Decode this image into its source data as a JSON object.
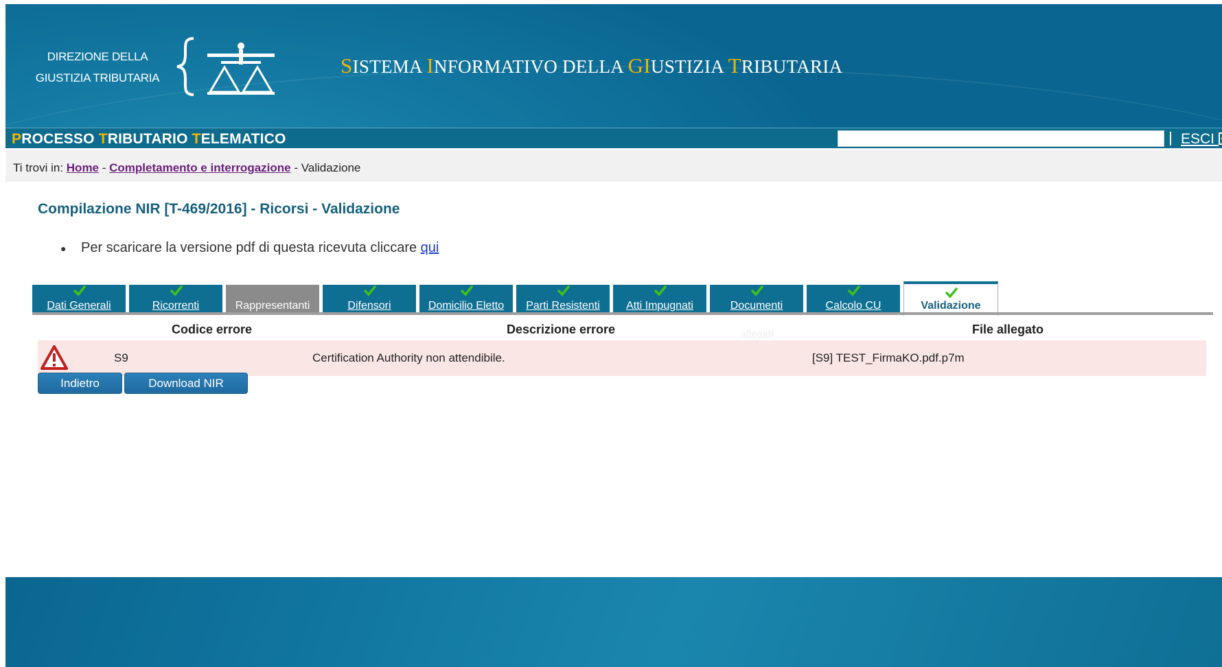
{
  "header": {
    "logo_line1": "DIREZIONE DELLA",
    "logo_line2": "GIUSTIZIA TRIBUTARIA",
    "system_title": {
      "p1": "S",
      "p2": "ISTEMA ",
      "p3": "I",
      "p4": "NFORMATIVO DELLA ",
      "p5": "GI",
      "p6": "USTIZIA ",
      "p7": "T",
      "p8": "RIBUTARIA"
    }
  },
  "ptt_bar": {
    "title": {
      "p1": "P",
      "p2": "ROCESSO ",
      "p3": "T",
      "p4": "RIBUTARIO ",
      "p5": "T",
      "p6": "ELEMATICO"
    },
    "search_value": "",
    "logout_label": "ESCI"
  },
  "breadcrumb": {
    "prefix": "Ti trovi in: ",
    "home": "Home",
    "sep": " - ",
    "section": "Completamento e interrogazione",
    "current": "Validazione"
  },
  "page_title": "Compilazione NIR [T-469/2016] - Ricorsi - Validazione",
  "notice": {
    "text": "Per scaricare la versione pdf di questa ricevuta cliccare ",
    "link": "qui"
  },
  "tabs": [
    {
      "label": "Dati Generali",
      "checked": true,
      "state": "link"
    },
    {
      "label": "Ricorrenti",
      "checked": true,
      "state": "link"
    },
    {
      "label": "Rappresentanti",
      "checked": false,
      "state": "disabled"
    },
    {
      "label": "Difensori",
      "checked": true,
      "state": "link"
    },
    {
      "label": "Domicilio Eletto",
      "checked": true,
      "state": "link"
    },
    {
      "label": "Parti Resistenti",
      "checked": true,
      "state": "link"
    },
    {
      "label": "Atti Impugnati",
      "checked": true,
      "state": "link"
    },
    {
      "label": "Documenti",
      "checked": true,
      "state": "link"
    },
    {
      "label": "Calcolo CU",
      "checked": true,
      "state": "link"
    },
    {
      "label": "Validazione",
      "checked": true,
      "state": "active"
    }
  ],
  "table": {
    "headers": [
      "Codice errore",
      "Descrizione errore",
      "File allegato"
    ],
    "hidden_link": "allegati",
    "rows": [
      {
        "icon": "warning-icon",
        "code": "S9",
        "description": "Certification Authority non attendibile.",
        "file": "[S9] TEST_FirmaKO.pdf.p7m"
      }
    ]
  },
  "buttons": {
    "back": "Indietro",
    "download": "Download NIR"
  },
  "colors": {
    "brand_blue": "#0d6b8e",
    "accent_gold": "#f5b400",
    "title_teal": "#17607e",
    "error_row": "#fbe6e6",
    "check_green": "#3ec11a"
  }
}
